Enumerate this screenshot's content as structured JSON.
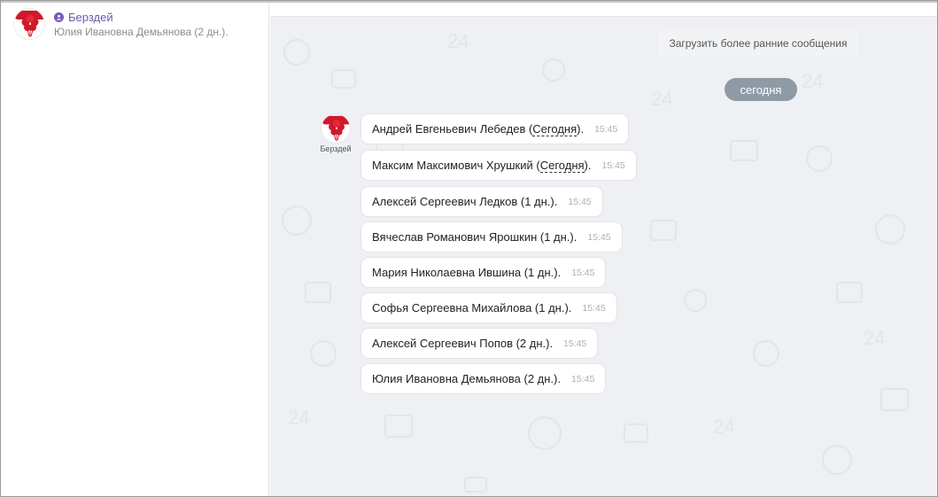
{
  "sidebar": {
    "chat": {
      "name": "Берздей",
      "preview": "Юлия Ивановна Демьянова (2 дн.)."
    }
  },
  "main": {
    "load_earlier": "Загрузить более ранние сообщения",
    "date_separator": "сегодня",
    "sender": {
      "name": "Берздей"
    },
    "messages": [
      {
        "text": "Андрей Евгеньевич Лебедев (",
        "link": "Сегодня",
        "suffix": ").",
        "time": "15:45"
      },
      {
        "text": "Максим Максимович Хрушкий (",
        "link": "Сегодня",
        "suffix": ").",
        "time": "15:45"
      },
      {
        "text": "Алексей Сергеевич Ледков (1 дн.).",
        "link": "",
        "suffix": "",
        "time": "15:45"
      },
      {
        "text": "Вячеслав Романович Ярошкин (1 дн.).",
        "link": "",
        "suffix": "",
        "time": "15:45"
      },
      {
        "text": "Мария Николаевна Ившина (1 дн.).",
        "link": "",
        "suffix": "",
        "time": "15:45"
      },
      {
        "text": "Софья Сергеевна Михайлова (1 дн.).",
        "link": "",
        "suffix": "",
        "time": "15:45"
      },
      {
        "text": "Алексей Сергеевич Попов (2 дн.).",
        "link": "",
        "suffix": "",
        "time": "15:45"
      },
      {
        "text": "Юлия Ивановна Демьянова (2 дн.).",
        "link": "",
        "suffix": "",
        "time": "15:45"
      }
    ]
  },
  "colors": {
    "accent": "#6f5aa8",
    "logo_red": "#d0182b",
    "date_pill": "#8e9aa6",
    "chat_background": "#eef0f3"
  },
  "icons": {
    "chat_avatar": "balloons-logo-icon",
    "group": "group-icon",
    "background": "doodle-pattern"
  }
}
